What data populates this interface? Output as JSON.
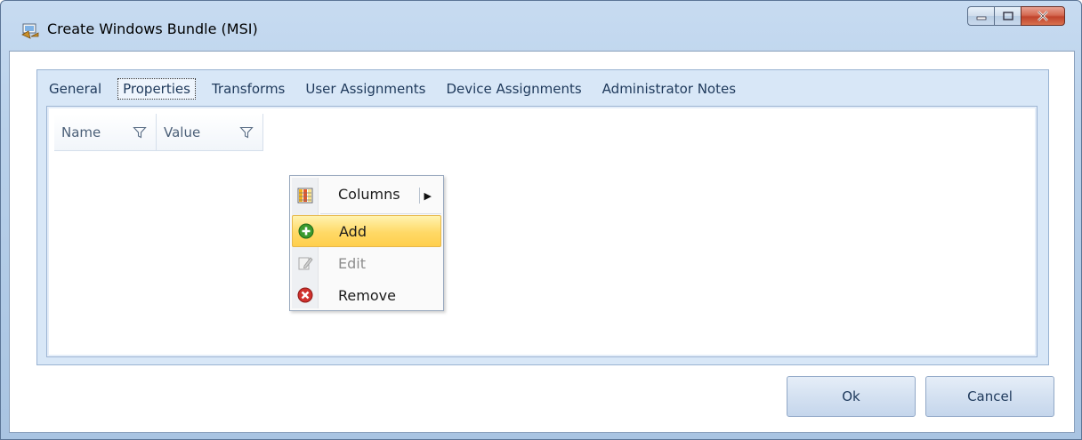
{
  "window": {
    "title": "Create Windows Bundle (MSI)",
    "icon": "bundle-installer-icon",
    "controls": [
      "minimize-icon",
      "maximize-icon",
      "close-icon"
    ]
  },
  "tabs": [
    {
      "label": "General",
      "active": false
    },
    {
      "label": "Properties",
      "active": true
    },
    {
      "label": "Transforms",
      "active": false
    },
    {
      "label": "User Assignments",
      "active": false
    },
    {
      "label": "Device Assignments",
      "active": false
    },
    {
      "label": "Administrator Notes",
      "active": false
    }
  ],
  "grid": {
    "columns": [
      {
        "label": "Name",
        "icon": "filter-icon"
      },
      {
        "label": "Value",
        "icon": "filter-icon"
      }
    ],
    "rows": []
  },
  "context_menu": {
    "items": [
      {
        "label": "Columns",
        "icon": "columns-icon",
        "submenu": true
      },
      {
        "label": "Add",
        "icon": "add-icon",
        "highlighted": true
      },
      {
        "label": "Edit",
        "icon": "edit-icon",
        "disabled": true
      },
      {
        "label": "Remove",
        "icon": "remove-icon"
      }
    ]
  },
  "buttons": {
    "ok": "Ok",
    "cancel": "Cancel"
  },
  "colors": {
    "frame": "#b9d1ea",
    "tab_panel": "#d8e7f7",
    "menu_highlight": "#ffd966",
    "add_green": "#3a9a2e",
    "remove_red": "#d0312d"
  }
}
